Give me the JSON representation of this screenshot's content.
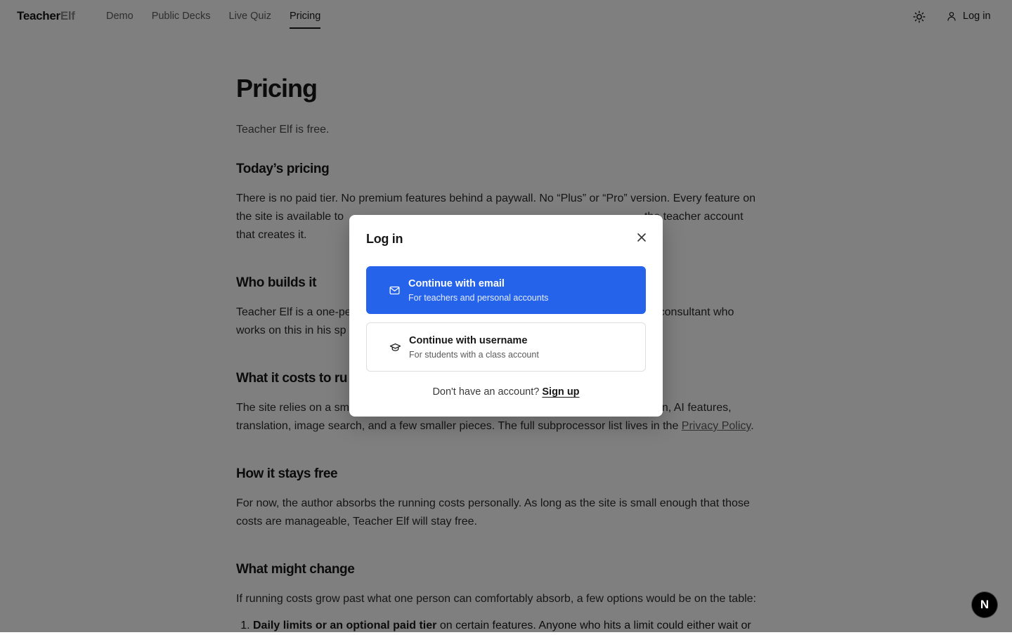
{
  "header": {
    "brand_part1": "Teacher",
    "brand_part2": "Elf",
    "nav": [
      {
        "label": "Demo"
      },
      {
        "label": "Public Decks"
      },
      {
        "label": "Live Quiz"
      },
      {
        "label": "Pricing",
        "active": true
      }
    ],
    "theme_toggle_icon": "sun-icon",
    "login_label": "Log in",
    "login_icon": "user-icon"
  },
  "article": {
    "title": "Pricing",
    "lead": "Teacher Elf is free.",
    "sections": [
      {
        "heading": "Today’s pricing",
        "body_line1": "There is no paid tier. No premium features behind a paywall. No “Plus” or “Pro” version. Every feature on",
        "body_line2_start": "the site is available to",
        "body_line2_end": "the teacher account",
        "body_line3": "that creates it."
      },
      {
        "heading": "Who builds it",
        "body_line1_start": "Teacher Elf is a one-pe",
        "body_line1_end": "consultant who",
        "body_line2_start": "works on this in his sp"
      },
      {
        "heading_visible": "What it costs to ru",
        "body_line1_start": "The site relies on a sm",
        "body_line1_end": "on, AI features,",
        "body_line2": "translation, image search, and a few smaller pieces. The full subprocessor list lives in the",
        "privacy_link": "Privacy Policy",
        "body_line2_end": "."
      },
      {
        "heading": "How it stays free",
        "body_line1": "For now, the author absorbs the running costs personally. As long as the site is small enough that those",
        "body_line2": "costs are manageable, Teacher Elf will stay free."
      },
      {
        "heading": "What might change",
        "body_line1": "If running costs grow past what one person can comfortably absorb, a few options would be on the table:",
        "list_item1_bold": "Daily limits or an optional paid tier",
        "list_item1_rest": "on certain features. Anyone who hits a limit could either wait or"
      }
    ]
  },
  "modal": {
    "title": "Log in",
    "close_icon": "close-icon",
    "email_option": {
      "title": "Continue with email",
      "subtitle": "For teachers and personal accounts",
      "icon": "mail-icon"
    },
    "username_option": {
      "title": "Continue with username",
      "subtitle": "For students with a class account",
      "icon": "graduation-cap-icon"
    },
    "footer_text": "Don't have an account?",
    "signup_label": "Sign up"
  },
  "badge": {
    "label": "N"
  },
  "colors": {
    "primary": "#2563eb",
    "overlay": "rgba(0,0,0,0.5)"
  }
}
